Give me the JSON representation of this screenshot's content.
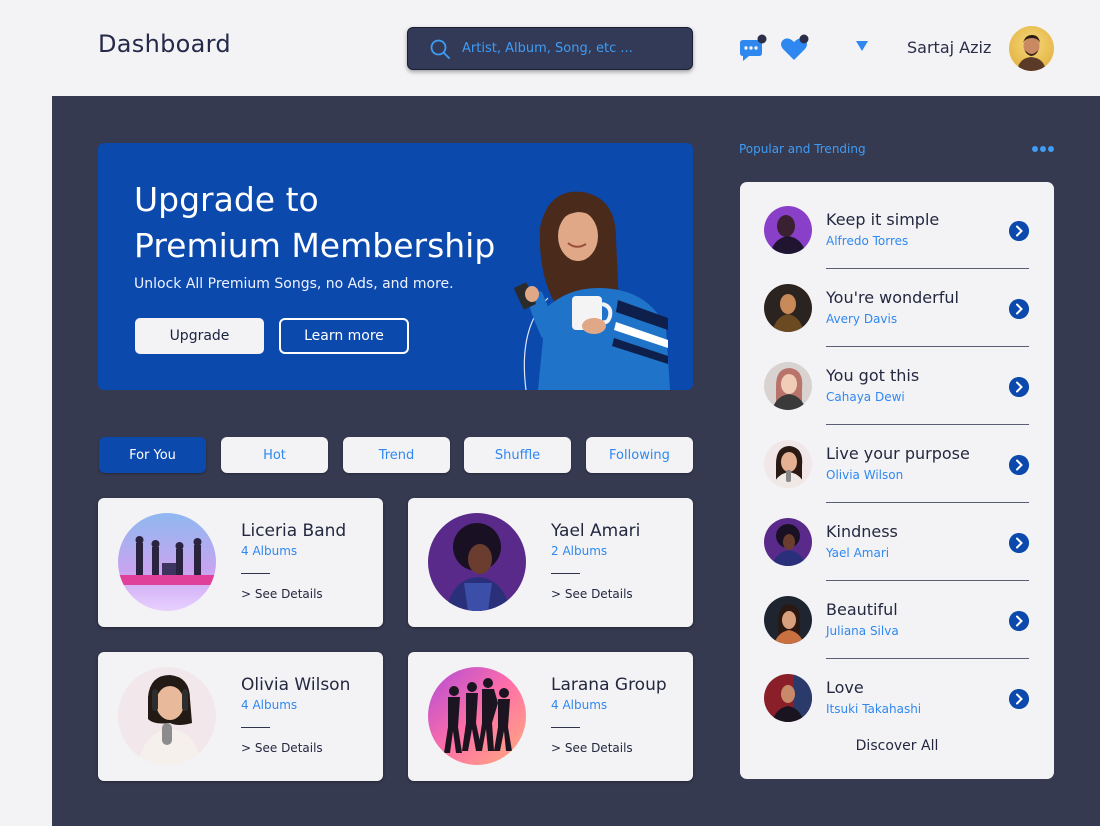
{
  "header": {
    "title": "Dashboard",
    "search_placeholder": "Artist, Album, Song, etc ...",
    "user_name": "Sartaj Aziz"
  },
  "banner": {
    "title_line1": "Upgrade to",
    "title_line2": "Premium Membership",
    "subtitle": "Unlock All Premium Songs, no Ads, and more.",
    "upgrade_label": "Upgrade",
    "learn_more_label": "Learn more"
  },
  "tabs": [
    {
      "label": "For You",
      "active": true
    },
    {
      "label": "Hot",
      "active": false
    },
    {
      "label": "Trend",
      "active": false
    },
    {
      "label": "Shuffle",
      "active": false
    },
    {
      "label": "Following",
      "active": false
    }
  ],
  "artists": [
    {
      "name": "Liceria Band",
      "albums": "4 Albums",
      "details": "> See Details"
    },
    {
      "name": "Yael Amari",
      "albums": "2 Albums",
      "details": "> See Details"
    },
    {
      "name": "Olivia Wilson",
      "albums": "4 Albums",
      "details": "> See Details"
    },
    {
      "name": "Larana Group",
      "albums": "4 Albums",
      "details": "> See Details"
    }
  ],
  "trending": {
    "heading": "Popular and Trending",
    "items": [
      {
        "song": "Keep it simple",
        "artist": "Alfredo Torres"
      },
      {
        "song": "You're wonderful",
        "artist": "Avery Davis"
      },
      {
        "song": "You got this",
        "artist": "Cahaya Dewi"
      },
      {
        "song": "Live your purpose",
        "artist": "Olivia Wilson"
      },
      {
        "song": "Kindness",
        "artist": "Yael Amari"
      },
      {
        "song": "Beautiful",
        "artist": "Juliana Silva"
      },
      {
        "song": "Love",
        "artist": "Itsuki Takahashi"
      }
    ],
    "discover_label": "Discover All"
  },
  "colors": {
    "accent": "#0b49ad",
    "link": "#2f88f0",
    "panel": "#363a50",
    "surface": "#f3f3f6"
  }
}
